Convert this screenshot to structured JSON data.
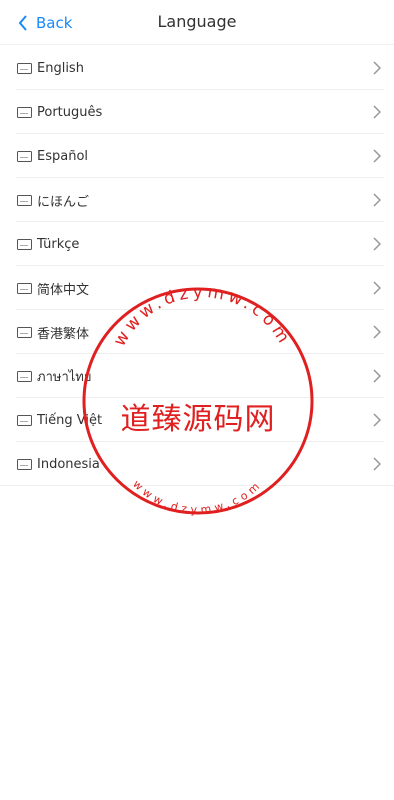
{
  "header": {
    "back_label": "Back",
    "title": "Language"
  },
  "languages": [
    {
      "label": "English"
    },
    {
      "label": "Português"
    },
    {
      "label": "Español"
    },
    {
      "label": "にほんご"
    },
    {
      "label": "Türkçe"
    },
    {
      "label": "简体中文"
    },
    {
      "label": "香港繁体"
    },
    {
      "label": "ภาษาไทย"
    },
    {
      "label": "Tiếng Việt"
    },
    {
      "label": "Indonesia"
    }
  ],
  "watermark": {
    "main_text": "道臻源码网",
    "outer_ring": "www.dzymw.com",
    "inner_ring": "www.dzymw.com",
    "color": "#e02020"
  },
  "colors": {
    "accent": "#1989fa",
    "text": "#323233",
    "chevron": "#969799",
    "stamp": "#e02020"
  }
}
